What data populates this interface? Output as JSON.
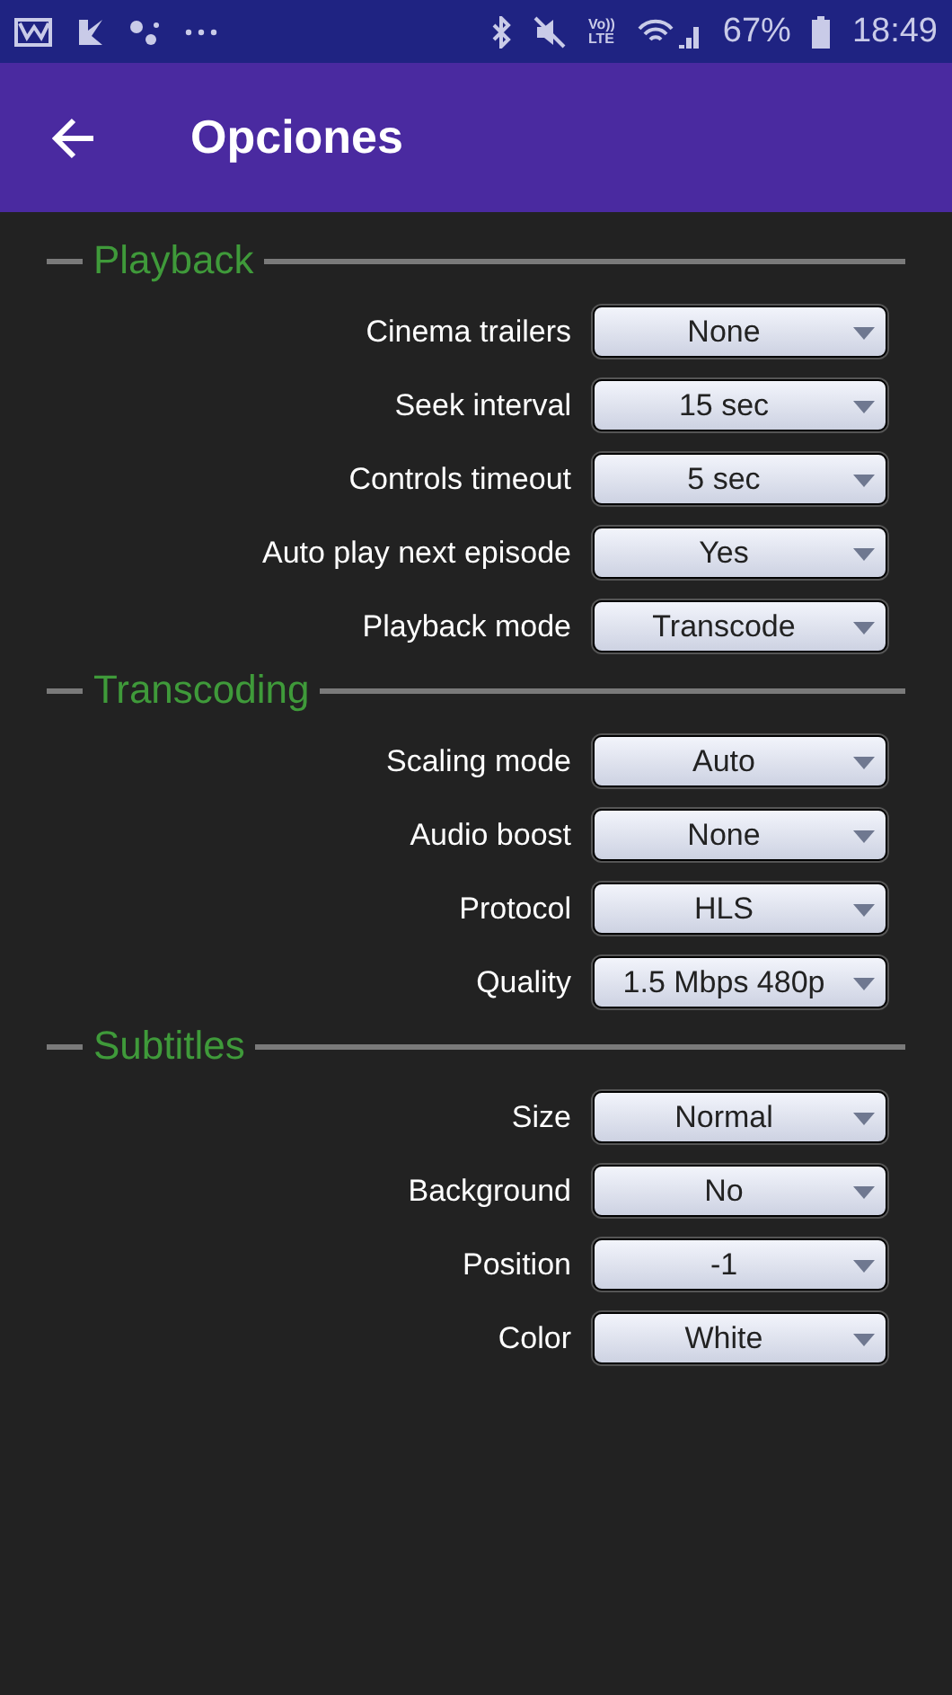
{
  "status_bar": {
    "lte_badge": [
      "Vo))",
      "LTE"
    ],
    "battery": "67%",
    "time": "18:49"
  },
  "app_bar": {
    "title": "Opciones"
  },
  "sections": [
    {
      "title": "Playback",
      "settings": [
        {
          "label": "Cinema trailers",
          "value": "None"
        },
        {
          "label": "Seek interval",
          "value": "15 sec"
        },
        {
          "label": "Controls timeout",
          "value": "5 sec"
        },
        {
          "label": "Auto play next episode",
          "value": "Yes"
        },
        {
          "label": "Playback mode",
          "value": "Transcode"
        }
      ]
    },
    {
      "title": "Transcoding",
      "settings": [
        {
          "label": "Scaling mode",
          "value": "Auto"
        },
        {
          "label": "Audio boost",
          "value": "None"
        },
        {
          "label": "Protocol",
          "value": "HLS"
        },
        {
          "label": "Quality",
          "value": "1.5 Mbps 480p"
        }
      ]
    },
    {
      "title": "Subtitles",
      "settings": [
        {
          "label": "Size",
          "value": "Normal"
        },
        {
          "label": "Background",
          "value": "No"
        },
        {
          "label": "Position",
          "value": "-1"
        },
        {
          "label": "Color",
          "value": "White"
        }
      ]
    }
  ]
}
